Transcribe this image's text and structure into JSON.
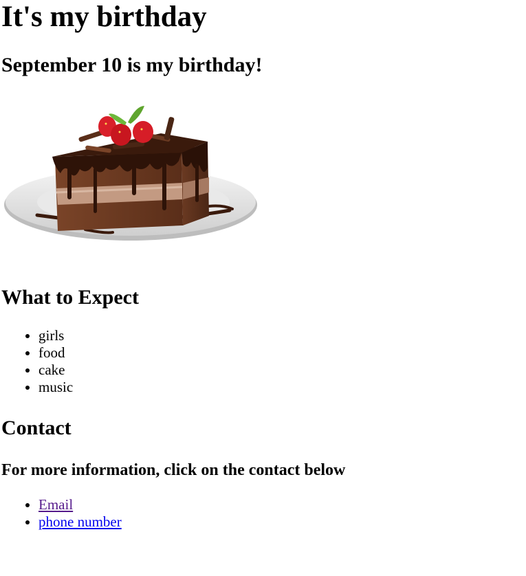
{
  "page": {
    "title": "It's my birthday",
    "subtitle": "September 10 is my birthday!"
  },
  "image": {
    "icon": "chocolate-cake-slice-image"
  },
  "expect": {
    "heading": "What to Expect",
    "items": [
      "girls",
      "food",
      "cake",
      "music"
    ]
  },
  "contact": {
    "heading": "Contact",
    "info": "For more information, click on the contact below",
    "links": [
      "Email",
      "phone number"
    ]
  }
}
